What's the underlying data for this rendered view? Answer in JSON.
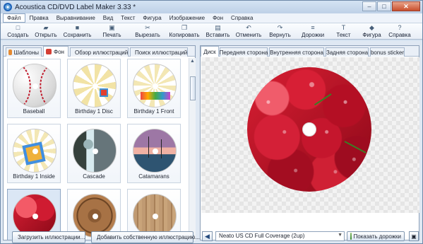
{
  "window": {
    "title": "Acoustica CD/DVD Label Maker 3.33 *",
    "controls": [
      "–",
      "□",
      "✕"
    ]
  },
  "menu": [
    "Файл",
    "Правка",
    "Выравнивание",
    "Вид",
    "Текст",
    "Фигура",
    "Изображение",
    "Фон",
    "Справка"
  ],
  "toolbar": [
    "Создать",
    "Открыть",
    "Сохранить",
    "Печать",
    "Вырезать",
    "Копировать",
    "Вставить",
    "Отменить",
    "Вернуть",
    "Дорожки",
    "Текст",
    "Фигура",
    "Справка"
  ],
  "left_tabs": [
    "Шаблоны",
    "Фон",
    "Обзор иллюстраций",
    "Поиск иллюстраций"
  ],
  "gallery": [
    {
      "label": "Baseball"
    },
    {
      "label": "Birthday 1 Disc"
    },
    {
      "label": "Birthday 1 Front"
    },
    {
      "label": "Birthday 1 Inside"
    },
    {
      "label": "Cascade"
    },
    {
      "label": "Catamarans"
    },
    {
      "label": ""
    },
    {
      "label": ""
    },
    {
      "label": ""
    }
  ],
  "left_buttons": {
    "load": "Загрузить иллюстрации...",
    "add": "Добавить собственную иллюстрацию..."
  },
  "right_tabs": [
    "Диск",
    "Передняя сторона",
    "Внутренняя сторона",
    "Задняя сторона",
    "bonus sticker"
  ],
  "bottom": {
    "label_type": "Neato US CD Full Coverage (2up)",
    "show_tracks": "Показать дорожки"
  }
}
